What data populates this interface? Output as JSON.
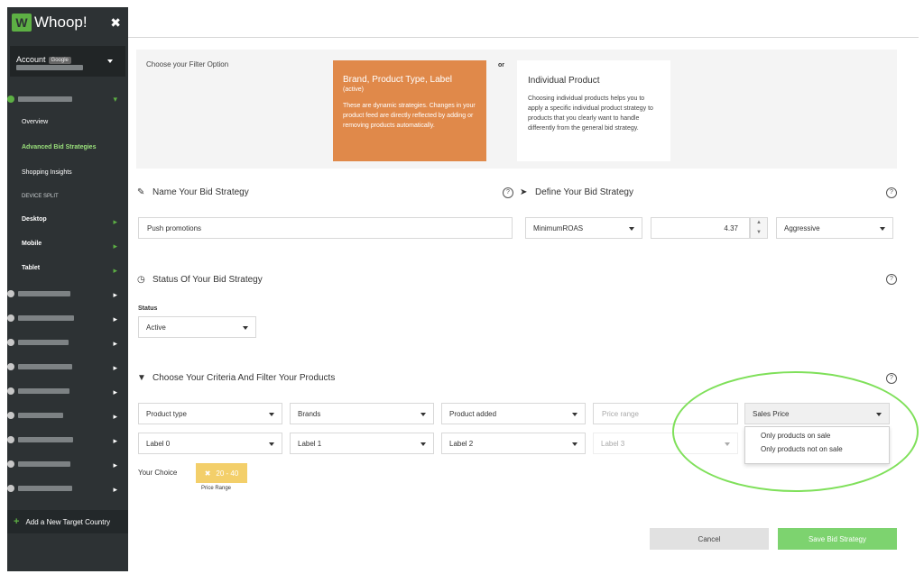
{
  "app": {
    "name": "Whoop!",
    "logo_letter": "W",
    "close_glyph": "✖"
  },
  "colors": {
    "accent_green": "#5db044",
    "active_card": "#e0894a",
    "chip": "#f3cf6a",
    "save_button": "#7dd36f",
    "highlight": "#7fe05a"
  },
  "sidebar": {
    "account_label": "Account",
    "account_badge": "Google",
    "nav": {
      "overview": "Overview",
      "advanced_bid": "Advanced Bid Strategies",
      "shopping_insights": "Shopping Insights",
      "device_split": "DEVICE SPLIT",
      "desktop": "Desktop",
      "mobile": "Mobile",
      "tablet": "Tablet"
    },
    "add_country": "Add a New Target Country",
    "add_glyph": "+",
    "chevron_glyph": "▸"
  },
  "filter": {
    "label": "Choose your Filter Option",
    "or": "or",
    "active_card": {
      "title": "Brand, Product Type, Label",
      "status": "(active)",
      "desc": "These are dynamic strategies. Changes in your product feed are directly reflected by adding or removing products automatically."
    },
    "individual_card": {
      "title": "Individual Product",
      "desc": "Choosing individual products helps you to apply a specific individual product strategy to products that you clearly want to handle differently from the general bid strategy."
    }
  },
  "name_section": {
    "title": "Name Your Bid Strategy",
    "value": "Push promotions",
    "icon": "pencil-icon"
  },
  "define_section": {
    "title": "Define Your Bid Strategy",
    "metric": "MinimumROAS",
    "target_value": "4.37",
    "mode": "Aggressive",
    "icon": "arrow-icon"
  },
  "status_section": {
    "title": "Status Of Your Bid Strategy",
    "field_label": "Status",
    "value": "Active",
    "icon": "clock-icon"
  },
  "criteria_section": {
    "title": "Choose Your Criteria And Filter Your Products",
    "icon": "filter-icon",
    "row1": [
      "Product type",
      "Brands",
      "Product added"
    ],
    "price_range_placeholder": "Price range",
    "sales_price": "Sales Price",
    "row2": [
      "Label 0",
      "Label 1",
      "Label 2",
      "Label 3"
    ],
    "dropdown_options": [
      "Only products on sale",
      "Only products not on sale"
    ],
    "your_choice_label": "Your Choice",
    "chip_text": "20 - 40",
    "chip_caption": "Price Range",
    "chip_remove": "✖"
  },
  "help_glyph": "?",
  "buttons": {
    "cancel": "Cancel",
    "save": "Save Bid Strategy"
  }
}
